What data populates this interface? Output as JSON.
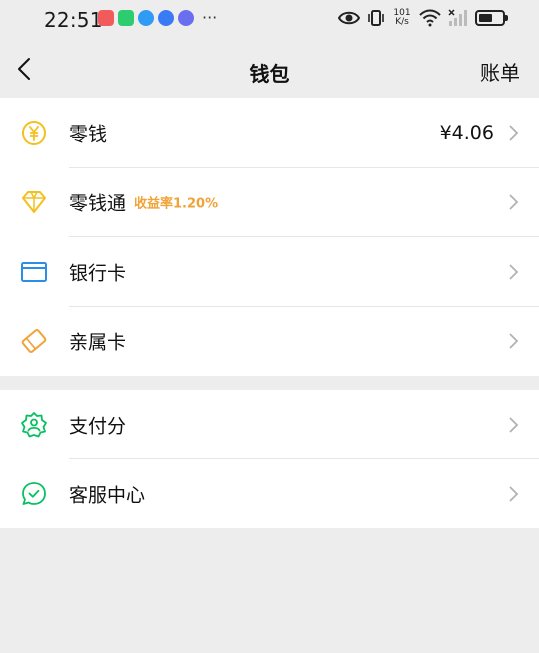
{
  "status_bar": {
    "time": "22:51",
    "more": "···",
    "netspeed_value": "101",
    "netspeed_unit": "K/s",
    "battery_level": 0.6,
    "app_icon_colors": [
      "#f25b5b",
      "#2ecc71",
      "#2f9bf4",
      "#3a7bf5",
      "#6a6ff0"
    ]
  },
  "nav": {
    "title": "钱包",
    "right_link": "账单"
  },
  "groups": [
    {
      "items": [
        {
          "label": "零钱",
          "value": "¥4.06",
          "icon": "yuan-coin-icon"
        },
        {
          "label": "零钱通",
          "tag": "收益率1.20%",
          "icon": "diamond-icon"
        },
        {
          "label": "银行卡",
          "icon": "bank-card-icon"
        },
        {
          "label": "亲属卡",
          "icon": "family-card-icon"
        }
      ]
    },
    {
      "items": [
        {
          "label": "支付分",
          "icon": "payment-score-icon"
        },
        {
          "label": "客服中心",
          "icon": "customer-service-icon"
        }
      ]
    }
  ],
  "colors": {
    "accent_green": "#07c160",
    "yellow": "#f4c01e",
    "orange_tag": "#f0a336",
    "blue": "#2a8ee6",
    "background": "#ededed"
  }
}
